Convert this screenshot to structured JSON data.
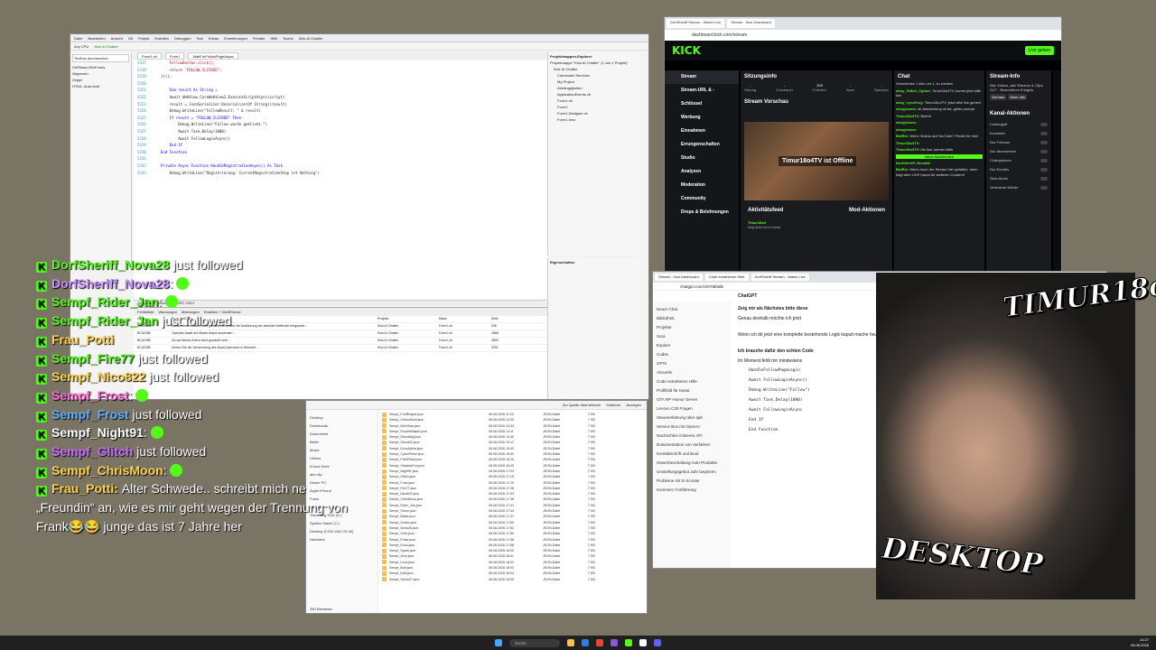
{
  "vs": {
    "menu": [
      "Datei",
      "Bearbeiten",
      "Ansicht",
      "Git",
      "Projekt",
      "Erstellen",
      "Debuggen",
      "Test",
      "Extras",
      "Erweiterungen",
      "Fenster",
      "Hilfe",
      "Suche",
      "Kick AI Chatter"
    ],
    "toolbar": [
      "Any CPU",
      "Kick AI Chatter"
    ],
    "toolbox_title": "Toolbox durchsuchen",
    "toolbox_items": [
      "CefSharp.WinForms",
      "Allgemein",
      "Zeiger",
      "HTML: Auto-bold"
    ],
    "tabs": [
      "Form1.vb",
      "Form1",
      "WaitForFollowPageAsync"
    ],
    "code": [
      {
        "n": "5317",
        "t": "    FollowButton.click();",
        "c": "str"
      },
      {
        "n": "5318",
        "t": "    return 'FOLLOW_CLICKED';",
        "c": "str"
      },
      {
        "n": "5319",
        "t": "})();",
        "c": ""
      },
      {
        "n": "5320",
        "t": "",
        "c": ""
      },
      {
        "n": "5321",
        "t": "    Dim result As String =",
        "c": "kw"
      },
      {
        "n": "5322",
        "t": "    Await WebView.CoreWebView2.ExecuteScriptAsync(script)",
        "c": ""
      },
      {
        "n": "5323",
        "t": "    result = JsonSerializer.Deserialize(Of String)(result)",
        "c": ""
      },
      {
        "n": "5324",
        "t": "    Debug.WriteLine(\"FollowResult: \" & result)",
        "c": ""
      },
      {
        "n": "5325",
        "t": "    If result = \"FOLLOW_CLICKED\" Then",
        "c": "kw"
      },
      {
        "n": "5326",
        "t": "        Debug.WriteLine(\"Follow wurde geklickt.\")",
        "c": ""
      },
      {
        "n": "5327",
        "t": "        Await Task.Delay(1000)",
        "c": ""
      },
      {
        "n": "5328",
        "t": "        Await FollowLoginAsync()",
        "c": ""
      },
      {
        "n": "5329",
        "t": "    End If",
        "c": "kw"
      },
      {
        "n": "5330",
        "t": "End Function",
        "c": "kw"
      },
      {
        "n": "5331",
        "t": "",
        "c": ""
      },
      {
        "n": "5332",
        "t": "Private Async Function HandleRegistrationAsync() As Task",
        "c": "kw"
      },
      {
        "n": "5333",
        "t": "    Debug.WriteLine(\"Registrierung: CurrentRegistrationStep ist Nothing\")",
        "c": ""
      }
    ],
    "status": "Zeile: 5332, Zeichen: 17  SPC  CRLF",
    "solution_title": "Projektmappen-Explorer",
    "solution_items": [
      "Projektmappe \"Kick AI Chatter\" (1 von 1 Projekt)",
      "Kick AI Chatter",
      "Connected Services",
      "My Project",
      "Abhängigkeiten",
      "ApplicationEvents.vb",
      "Form1.vb",
      "Form1",
      "Form1.Designer.vb",
      "Form1.resx"
    ],
    "props_title": "Eigenschaften",
    "error_tabs": [
      "Fehlerliste",
      "Warnungen",
      "Meldungen",
      "Erstellen + IntelliSense"
    ],
    "error_headers": [
      "Code",
      "Beschreibung",
      "Projekt",
      "Datei",
      "Zeile"
    ],
    "errors": [
      {
        "code": "BC42358",
        "desc": "Da auf diesen Aufruf nicht gewartet wird, wird die Ausführung der aktuellen Methode fortgesetzt ...",
        "proj": "Kick AI Chatter",
        "file": "Form1.vb",
        "line": "535"
      },
      {
        "code": "BC42358",
        "desc": "Operator Await auf diesen Aufruf anwenden ...",
        "proj": "Kick AI Chatter",
        "file": "Form1.vb",
        "line": "2886"
      },
      {
        "code": "BC42358",
        "desc": "Da auf diesen Aufruf nicht gewartet wird ...",
        "proj": "Kick AI Chatter",
        "file": "Form1.vb",
        "line": "2899"
      },
      {
        "code": "BC42358",
        "desc": "Ziehen Sie die Verwendung des Await-Operators in Betracht ...",
        "proj": "Kick AI Chatter",
        "file": "Form1.vb",
        "line": "3291"
      }
    ]
  },
  "kick": {
    "tabs": [
      "DorfSheriff Stream - Watch Live",
      "Stream - Kick Dashboard"
    ],
    "url": "dashboard.kick.com/stream",
    "logo": "KICK",
    "golive": "Live gehen",
    "nav": [
      "Stream",
      "Stream-URL & -Schlüssel",
      "Werbung",
      "Einnahmen",
      "Errungenschaften",
      "Studio",
      "Analysen",
      "Moderation",
      "Community",
      "Drops & Belohnungen"
    ],
    "session_title": "Sitzungsinfo",
    "session_status": "OFFLINE",
    "session_stats": [
      {
        "label": "Sitzung",
        "value": "-"
      },
      {
        "label": "Zuschauer",
        "value": "-"
      },
      {
        "label": "Follower",
        "value": "209"
      },
      {
        "label": "Abos",
        "value": "-"
      },
      {
        "label": "Spenden",
        "value": "-"
      }
    ],
    "preview_title": "Stream Vorschau",
    "offline_text": "Timur18o4TV ist Offline",
    "activity_title": "Aktivitätsfeed",
    "mod_title": "Mod-Aktionen",
    "activity_item": {
      "name": "Timur18o4",
      "text": "folgt jetzt dem Kanal"
    },
    "chat_title": "Chat",
    "chat": [
      {
        "user": "",
        "text": "Verschenke 1 Abo um 1. zu werden"
      },
      {
        "user": "sbny_Glitch_Cipher",
        "text": "Timur18o4TV, komm jetzt bitte live"
      },
      {
        "user": "sbny_LynxFury",
        "text": "Timur18o4TV, jetzt bitte live gehen!"
      },
      {
        "user": "sbnyjesses",
        "text": "ok abweichung ist da, geiler prompt"
      },
      {
        "user": "Timur18o4TV",
        "text": "Befehl"
      },
      {
        "user": "sbnyjesses",
        "text": ""
      },
      {
        "user": "sbnyjesses",
        "text": ""
      },
      {
        "user": "BotRix",
        "text": "Wenn Videos auf YouTube? Findet ihr hier!"
      },
      {
        "user": "Timur18o4TV",
        "text": ""
      },
      {
        "user": "Timur18o4TV",
        "text": "bin live, komm rüber"
      }
    ],
    "new_messages": "Neue Nachrichten",
    "chat_tail": [
      {
        "user": "DorfSheriff_Nova28",
        "text": ""
      },
      {
        "user": "BotRix",
        "text": "Wenn euch der Stream hier gefallen, dann folgt dem LIVE Kanal für weiteren Content!"
      }
    ],
    "stream_info_title": "Stream-Info",
    "stream_info_text": "Alte Videos, alte Streams & Clips 24/7 - Besonderes Ereignis",
    "tags": [
      "German",
      "More Info"
    ],
    "channel_actions_title": "Kanal-Aktionen",
    "channel_actions": [
      "Chatzugriff",
      "Kontakter",
      "Nur Follower",
      "Nur Abonnenten",
      "Chatoptionen",
      "Nur Emotes",
      "Slow-Mode",
      "Verbotene Wörter"
    ]
  },
  "gpt": {
    "tabs": [
      "Stream - Kick Dashboard",
      "Code extrahieren Hilfe",
      "DorfSheriff Stream - Watch Live"
    ],
    "url": "chatgpt.com/c/6766fa9b",
    "title": "ChatGPT",
    "sidebar": [
      "Neuer Chat",
      "Bibliothek",
      "Projekte",
      "Sora",
      "Explore",
      "Codex",
      "GPTs",
      "Aktuelle",
      "Code extrahieren Hilfe",
      "Profilbild für Kanal",
      "GTA RP Humor Server",
      "Lenovo C30 Fragen",
      "Steuererklärung über apk",
      "Service Box mit OpenAI",
      "Nachrichten imitieren API",
      "Dokumentation von Verfahren",
      "Kontaktschrift und Boot",
      "Gewerbeschaltung Auto Produkte",
      "Umstellungsgebot Jahr beginnen",
      "Probleme mit E-Scooter",
      "Kommerz Fortführung"
    ],
    "main": [
      "Zeig mir als Nächstes bitte diese",
      "Genau deshalb möchte ich jetzt",
      "Wenn ich dir jetzt eine komplette bestehende Logik kaputt mache heute oft genug erlebt.",
      "Ich brauche dafür den echten Code",
      "Im Moment fehlt mir mindestens",
      "HandleFollowPageLogin",
      "Await FollowLoginAsync()",
      "Debug.WriteLine(\"Follow\")",
      "Await Task.Delay(1000)",
      "Await FollowLoginAsync",
      "End If",
      "End Function"
    ]
  },
  "explorer": {
    "toolbar": [
      "Zur Quelle übernehmen",
      "Sortieren",
      "Anzeigen"
    ],
    "nav": [
      "Desktop",
      "Downloads",
      "Dokumente",
      "Bilder",
      "Musik",
      "Videos",
      "iCloud Drive",
      "abc clip",
      "Dieser PC",
      "Apple iPhone",
      "Fotos",
      "OLD Games (E:)",
      "Streaming SSD (G:)",
      "System Daten (C:)",
      "Desktop (\\\\192.168.178.34)",
      "Netzwerk"
    ],
    "files": [
      {
        "name": "Sempf_FortReaper.json",
        "date": "06.08.2026 11:20",
        "type": "JSON-Datei",
        "size": "7 KB"
      },
      {
        "name": "Sempf_CitrinoSolid.json",
        "date": "06.08.2026 12:05",
        "type": "JSON-Datei",
        "size": "7 KB"
      },
      {
        "name": "Sempf_NeoVista.json",
        "date": "06.08.2026 13:44",
        "type": "JSON-Datei",
        "size": "7 KB"
      },
      {
        "name": "Sempf_RocketMaster.json",
        "date": "06.08.2026 14:11",
        "type": "JSON-Datei",
        "size": "7 KB"
      },
      {
        "name": "Sempf_GhostAlly.json",
        "date": "06.08.2026 14:40",
        "type": "JSON-Datei",
        "size": "7 KB"
      },
      {
        "name": "Sempf_Ghost02.json",
        "date": "06.08.2026 15:12",
        "type": "JSON-Datei",
        "size": "7 KB"
      },
      {
        "name": "Sempf_EchoAlpha.json",
        "date": "06.08.2026 15:40",
        "type": "JSON-Datei",
        "size": "7 KB"
      },
      {
        "name": "Sempf_CyberPulse.json",
        "date": "06.08.2026 16:02",
        "type": "JSON-Datei",
        "size": "7 KB"
      },
      {
        "name": "Sempf_PixelRider.json",
        "date": "06.08.2026 16:25",
        "type": "JSON-Datei",
        "size": "7 KB"
      },
      {
        "name": "Sempf_ShadowFox.json",
        "date": "06.08.2026 16:49",
        "type": "JSON-Datei",
        "size": "7 KB"
      },
      {
        "name": "Sempf_Night91.json",
        "date": "06.08.2026 17:03",
        "type": "JSON-Datei",
        "size": "7 KB"
      },
      {
        "name": "Sempf_Glitch.json",
        "date": "06.08.2026 17:15",
        "type": "JSON-Datei",
        "size": "7 KB"
      },
      {
        "name": "Sempf_Frost.json",
        "date": "06.08.2026 17:20",
        "type": "JSON-Datei",
        "size": "7 KB"
      },
      {
        "name": "Sempf_Fire77.json",
        "date": "06.08.2026 17:28",
        "type": "JSON-Datei",
        "size": "7 KB"
      },
      {
        "name": "Sempf_Nico822.json",
        "date": "06.08.2026 17:33",
        "type": "JSON-Datei",
        "size": "7 KB"
      },
      {
        "name": "Sempf_ChrisMoon.json",
        "date": "06.08.2026 17:38",
        "type": "JSON-Datei",
        "size": "7 KB"
      },
      {
        "name": "Sempf_Rider_Jan.json",
        "date": "06.08.2026 17:41",
        "type": "JSON-Datei",
        "size": "7 KB"
      },
      {
        "name": "Sempf_Storm.json",
        "date": "06.08.2026 17:44",
        "type": "JSON-Datei",
        "size": "7 KB"
      },
      {
        "name": "Sempf_Blaze.json",
        "date": "06.08.2026 17:47",
        "type": "JSON-Datei",
        "size": "7 KB"
      },
      {
        "name": "Sempf_Vortex.json",
        "date": "06.08.2026 17:50",
        "type": "JSON-Datei",
        "size": "7 KB"
      },
      {
        "name": "Sempf_Nova28.json",
        "date": "06.08.2026 17:52",
        "type": "JSON-Datei",
        "size": "7 KB"
      },
      {
        "name": "Sempf_Orbit.json",
        "date": "06.08.2026 17:54",
        "type": "JSON-Datei",
        "size": "7 KB"
      },
      {
        "name": "Sempf_Pulse.json",
        "date": "06.08.2026 17:56",
        "type": "JSON-Datei",
        "size": "7 KB"
      },
      {
        "name": "Sempf_Echo.json",
        "date": "06.08.2026 17:58",
        "type": "JSON-Datei",
        "size": "7 KB"
      },
      {
        "name": "Sempf_Spark.json",
        "date": "06.08.2026 18:00",
        "type": "JSON-Datei",
        "size": "7 KB"
      },
      {
        "name": "Sempf_Zero.json",
        "date": "06.08.2026 18:01",
        "type": "JSON-Datei",
        "size": "7 KB"
      },
      {
        "name": "Sempf_Luna.json",
        "date": "06.08.2026 18:02",
        "type": "JSON-Datei",
        "size": "7 KB"
      },
      {
        "name": "Sempf_Bolt.json",
        "date": "06.08.2026 18:03",
        "type": "JSON-Datei",
        "size": "7 KB"
      },
      {
        "name": "Sempf_Drift.json",
        "date": "06.08.2026 18:04",
        "type": "JSON-Datei",
        "size": "7 KB"
      },
      {
        "name": "Sempf_Storm27.json",
        "date": "06.08.2026 18:05",
        "type": "JSON-Datei",
        "size": "7 KB"
      }
    ],
    "status": "250 Elemente"
  },
  "overlay": [
    {
      "name": "DorfSheriff_Nova28",
      "text": "just followed",
      "color": "#53fc18",
      "emote": false
    },
    {
      "name": "DorfSheriff_Nova28",
      "text": ":",
      "color": "#c88fff",
      "emote": true
    },
    {
      "name": "Sempf_Rider_Jan",
      "text": ":",
      "color": "#53fc18",
      "emote": true
    },
    {
      "name": "Sempf_Rider_Jan",
      "text": "just followed",
      "color": "#53fc18",
      "emote": false
    },
    {
      "name": "Frau_Potti",
      "text": "",
      "color": "#ffd24a",
      "emote": false
    },
    {
      "name": "Sempf_Fire77",
      "text": "just followed",
      "color": "#53fc18",
      "emote": false
    },
    {
      "name": "Sempf_Nico822",
      "text": "just followed",
      "color": "#ffd24a",
      "emote": false
    },
    {
      "name": "Sempf_Frost",
      "text": ":",
      "color": "#ff6ad5",
      "emote": true
    },
    {
      "name": "Sempf_Frost",
      "text": "just followed",
      "color": "#5ab0ff",
      "emote": false
    },
    {
      "name": "Sempf_Night91",
      "text": ":",
      "color": "#ffffff",
      "emote": true
    },
    {
      "name": "Sempf_Glitch",
      "text": "just followed",
      "color": "#c86bff",
      "emote": false
    },
    {
      "name": "Sempf_ChrisMoon",
      "text": ":",
      "color": "#ffd24a",
      "emote": true
    }
  ],
  "overlay_message": {
    "name": "Frau_Potti",
    "lines": [
      "Alter Schwede.. schreibt mich ne",
      "„Freundin“ an, wie es mir geht wegen der Trennung von",
      "Frank😂😂 junge das ist 7 Jahre her"
    ]
  },
  "webcam": {
    "brand_top": "TIMUR18o4",
    "brand_bottom": "DESKTOP"
  },
  "taskbar": {
    "search": "Suche",
    "time": "14:27",
    "date": "06.08.2026"
  },
  "colors": {
    "kick_green": "#53fc18",
    "desktop": "#7a7465"
  }
}
